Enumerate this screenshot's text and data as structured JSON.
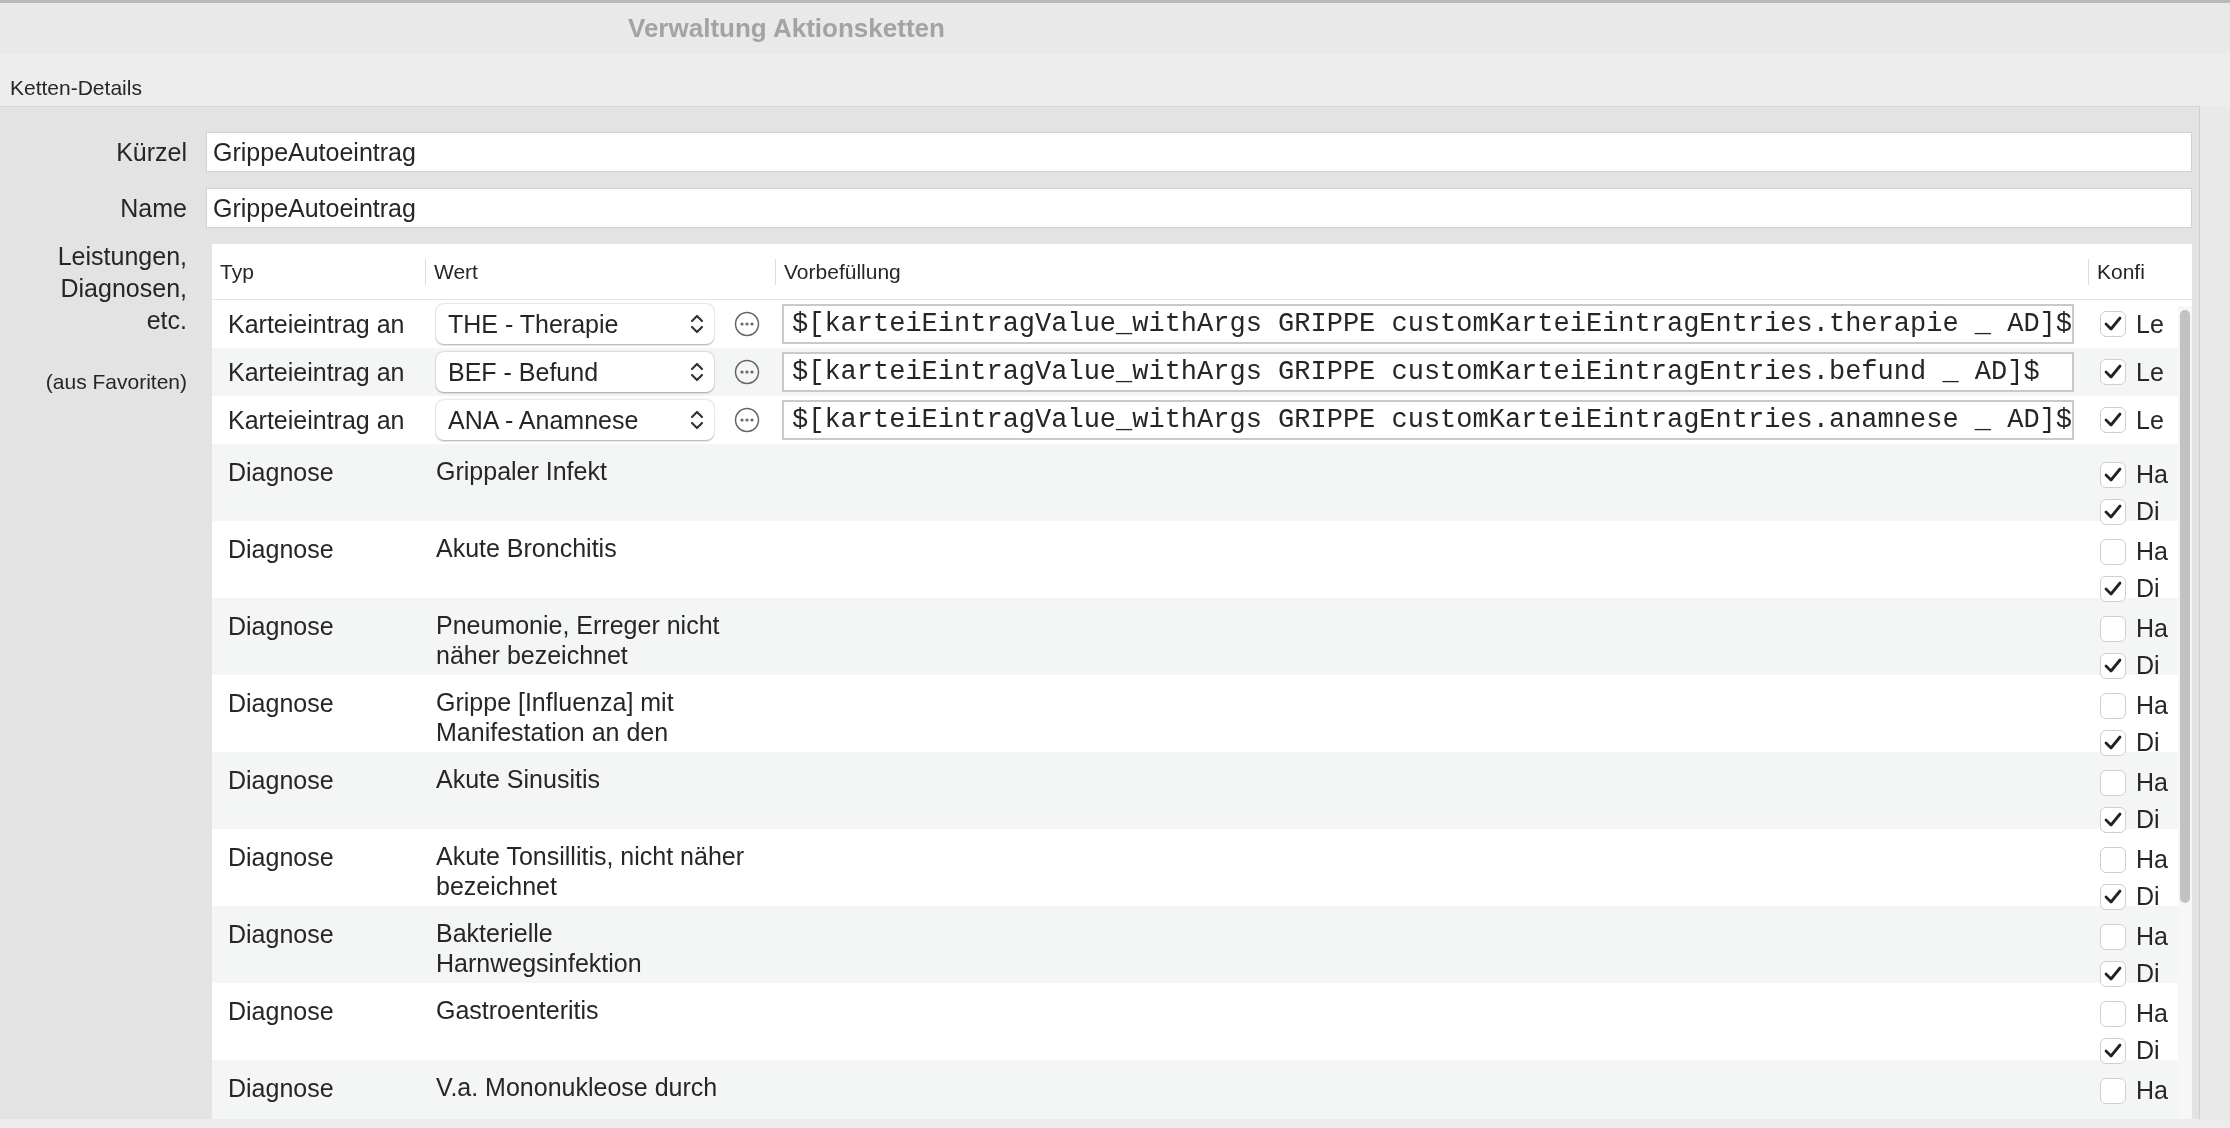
{
  "window": {
    "title": "Verwaltung Aktionsketten"
  },
  "section": {
    "title": "Ketten-Details"
  },
  "fields": [
    {
      "label": "Kürzel",
      "value": "GrippeAutoeintrag"
    },
    {
      "label": "Name",
      "value": "GrippeAutoeintrag"
    }
  ],
  "table_label": "Leistungen, Diagnosen, etc.",
  "table_note": "(aus Favoriten)",
  "table": {
    "columns": [
      "Typ",
      "Wert",
      "Vorbefüllung",
      "Konfi"
    ],
    "rows": [
      {
        "kind": "entry",
        "type": "Karteieintrag an",
        "value": "THE - Therapie",
        "prefill": "$[karteiEintragValue_withArgs GRIPPE customKarteiEintragEntries.therapie _ AD]$",
        "options": [
          {
            "label": "Le",
            "checked": true
          }
        ]
      },
      {
        "kind": "entry",
        "type": "Karteieintrag an",
        "value": "BEF - Befund",
        "prefill": "$[karteiEintragValue_withArgs GRIPPE customKarteiEintragEntries.befund _ AD]$",
        "options": [
          {
            "label": "Le",
            "checked": true
          }
        ]
      },
      {
        "kind": "entry",
        "type": "Karteieintrag an",
        "value": "ANA - Anamnese",
        "prefill": "$[karteiEintragValue_withArgs GRIPPE customKarteiEintragEntries.anamnese _ AD]$",
        "options": [
          {
            "label": "Le",
            "checked": true
          }
        ]
      },
      {
        "kind": "diagnosis",
        "type": "Diagnose",
        "value": "Grippaler Infekt",
        "options": [
          {
            "label": "Ha",
            "checked": true
          },
          {
            "label": "Di",
            "checked": true
          }
        ]
      },
      {
        "kind": "diagnosis",
        "type": "Diagnose",
        "value": "Akute Bronchitis",
        "options": [
          {
            "label": "Ha",
            "checked": false
          },
          {
            "label": "Di",
            "checked": true
          }
        ]
      },
      {
        "kind": "diagnosis",
        "type": "Diagnose",
        "value": "Pneumonie, Erreger nicht näher bezeichnet",
        "options": [
          {
            "label": "Ha",
            "checked": false
          },
          {
            "label": "Di",
            "checked": true
          }
        ]
      },
      {
        "kind": "diagnosis",
        "type": "Diagnose",
        "value": "Grippe [Influenza] mit Manifestation an den",
        "options": [
          {
            "label": "Ha",
            "checked": false
          },
          {
            "label": "Di",
            "checked": true
          }
        ]
      },
      {
        "kind": "diagnosis",
        "type": "Diagnose",
        "value": "Akute Sinusitis",
        "options": [
          {
            "label": "Ha",
            "checked": false
          },
          {
            "label": "Di",
            "checked": true
          }
        ]
      },
      {
        "kind": "diagnosis",
        "type": "Diagnose",
        "value": "Akute Tonsillitis, nicht näher bezeichnet",
        "options": [
          {
            "label": "Ha",
            "checked": false
          },
          {
            "label": "Di",
            "checked": true
          }
        ]
      },
      {
        "kind": "diagnosis",
        "type": "Diagnose",
        "value": "Bakterielle Harnwegsinfektion",
        "options": [
          {
            "label": "Ha",
            "checked": false
          },
          {
            "label": "Di",
            "checked": true
          }
        ]
      },
      {
        "kind": "diagnosis",
        "type": "Diagnose",
        "value": "Gastroenteritis",
        "options": [
          {
            "label": "Ha",
            "checked": false
          },
          {
            "label": "Di",
            "checked": true
          }
        ]
      },
      {
        "kind": "diagnosis",
        "type": "Diagnose",
        "value": "V.a. Mononukleose durch",
        "options": [
          {
            "label": "Ha",
            "checked": false
          }
        ]
      }
    ]
  }
}
